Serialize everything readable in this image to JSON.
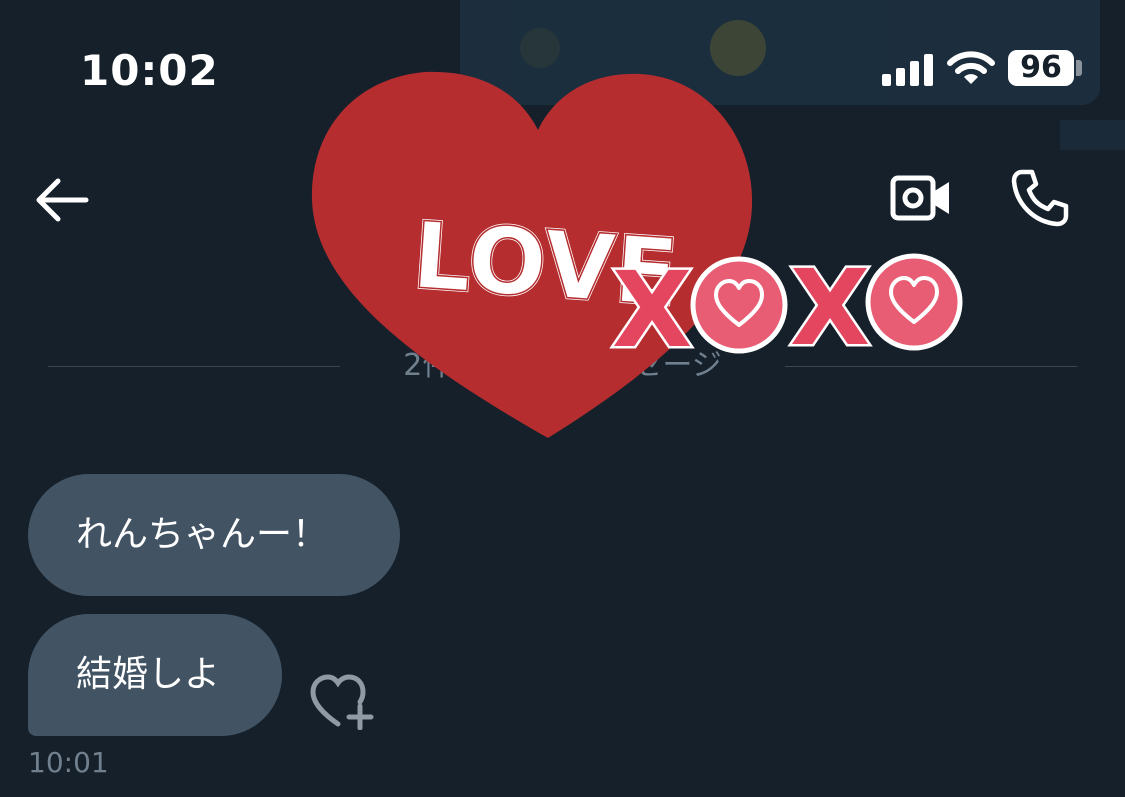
{
  "status_bar": {
    "time": "10:02",
    "battery": "96",
    "signal_icon": "cellular-signal-icon",
    "wifi_icon": "wifi-icon"
  },
  "header": {
    "back_icon": "back-arrow-icon",
    "video_icon": "video-call-icon",
    "phone_icon": "phone-call-icon"
  },
  "divider": {
    "text": "2件の新しいメッセージ"
  },
  "messages": [
    {
      "text": "れんちゃんー！"
    },
    {
      "text": "結婚しよ"
    }
  ],
  "message_time": "10:01",
  "reaction_icon": "heart-plus-icon",
  "sticker": {
    "love_text": "LOVE",
    "xoxo_x": "X",
    "icon": "love-xoxo-heart-sticker"
  },
  "colors": {
    "background": "#15202b",
    "bubble": "#425464",
    "heart_red": "#b52d2f",
    "xoxo_pink": "#e4455f"
  }
}
